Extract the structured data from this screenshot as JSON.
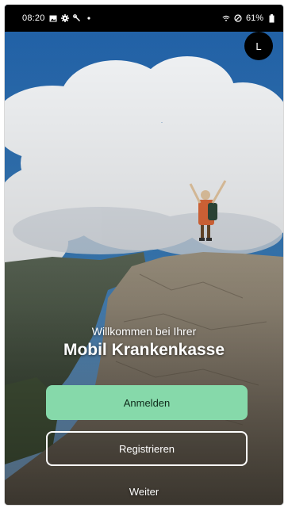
{
  "status_bar": {
    "time": "08:20",
    "battery_percent": "61%",
    "left_icons": [
      "image-icon",
      "gear-icon",
      "wrench-icon",
      "dot-icon"
    ],
    "right_icons": [
      "wifi-icon",
      "do-not-disturb-icon",
      "battery-icon"
    ]
  },
  "avatar": {
    "initial": "L"
  },
  "welcome": {
    "greeting": "Willkommen bei Ihrer",
    "brand": "Mobil Krankenkasse"
  },
  "actions": {
    "login_label": "Anmelden",
    "register_label": "Registrieren",
    "skip_label": "Weiter"
  },
  "colors": {
    "login_button": "#86d9aa",
    "status_bar": "#000000",
    "sky": "#2f6fb0"
  }
}
